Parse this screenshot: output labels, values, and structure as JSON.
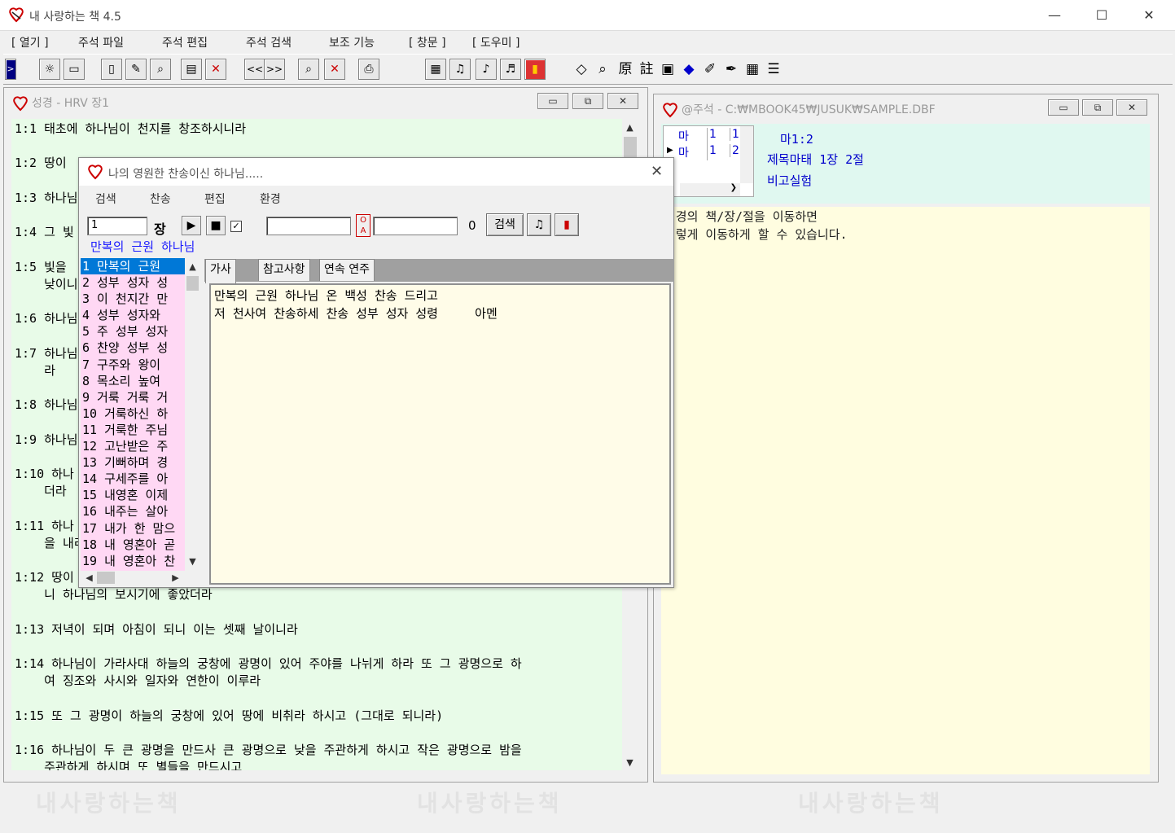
{
  "app": {
    "title": "내 사랑하는 책 4.5",
    "minimize": "—",
    "maximize": "☐",
    "close": "✕"
  },
  "menu": [
    "[ 열기 ]",
    "주석 파일",
    "주석 편집",
    "주석 검색",
    "보조 기능",
    "[ 창문 ]",
    "[ 도우미 ]"
  ],
  "toolbar": {
    "text_buttons": [
      "<<",
      ">>"
    ],
    "hanja1": "原",
    "hanja2": "註"
  },
  "bible": {
    "title": "성경 - HRV 장1",
    "verses": [
      "1:1 태초에 하나님이 천지를 창조하시니라",
      "1:2 땅이",
      "1:3 하나님",
      "1:4 그 빛",
      "1:5 빛을\n    낮이니",
      "1:6 하나님",
      "1:7 하나님\n    라",
      "1:8 하나님",
      "1:9 하나님",
      "1:10 하나\n    더라",
      "1:11 하나\n    을 내리",
      "1:12 땅이\n    니 하나님의 보시기에 좋았더라",
      "1:13 저녁이 되며 아침이 되니 이는 셋째 날이니라",
      "1:14 하나님이 가라사대 하늘의 궁창에 광명이 있어 주야를 나뉘게 하라 또 그 광명으로 하\n    여 징조와 사시와 일자와 연한이 이루라",
      "1:15 또 그 광명이 하늘의 궁창에 있어 땅에 비취라 하시고 (그대로 되니라)",
      "1:16 하나님이 두 큰 광명을 만드사 큰 광명으로 낮을 주관하게 하시고 작은 광명으로 밤을\n    주관하게 하시며 또 별들을 만드시고"
    ]
  },
  "hymn": {
    "title": "나의 영원한 찬송이신 하나님.....",
    "menu": [
      "검색",
      "찬송",
      "편집",
      "환경"
    ],
    "number_value": "1",
    "jang_label": "장",
    "check_mark": "✓",
    "search_value": "",
    "search2_value": "",
    "count": "0",
    "search_button": "검색",
    "current_title": "만복의 근원 하나님",
    "list": [
      "1   만복의 근원",
      "2   성부 성자 성",
      "3   이 천지간 만",
      "4   성부 성자와",
      "5   주 성부 성자",
      "6   찬양 성부 성",
      "7   구주와 왕이",
      "8   목소리 높여",
      "9   거룩 거룩 거",
      "10  거룩하신 하",
      "11  거룩한 주님",
      "12  고난받은 주",
      "13  기뻐하며 경",
      "14  구세주를 아",
      "15  내영혼 이제",
      "16  내주는 살아",
      "17  내가 한 맘으",
      "18  내 영혼아 곧",
      "19  내 영혼아 찬"
    ],
    "tabs": [
      "가사",
      "참고사항",
      "연속 연주"
    ],
    "lyrics": [
      "만복의 근원 하나님 온 백성 찬송 드리고",
      "저 천사여 찬송하세 찬송 성부 성자 성령     아멘"
    ]
  },
  "notes": {
    "title": "@주석 - C:₩MBOOK45₩JUSUK₩SAMPLE.DBF",
    "grid": [
      [
        "마",
        "1",
        "1"
      ],
      [
        "마",
        "1",
        "2"
      ]
    ],
    "ref": "마1:2",
    "line1": "제목마태 1장 2절",
    "line2": "비고실험",
    "body": [
      "성경의 책/장/절을 이동하면",
      "이렇게 이동하게 할 수 있습니다."
    ]
  },
  "watermark": "내사랑하는책"
}
